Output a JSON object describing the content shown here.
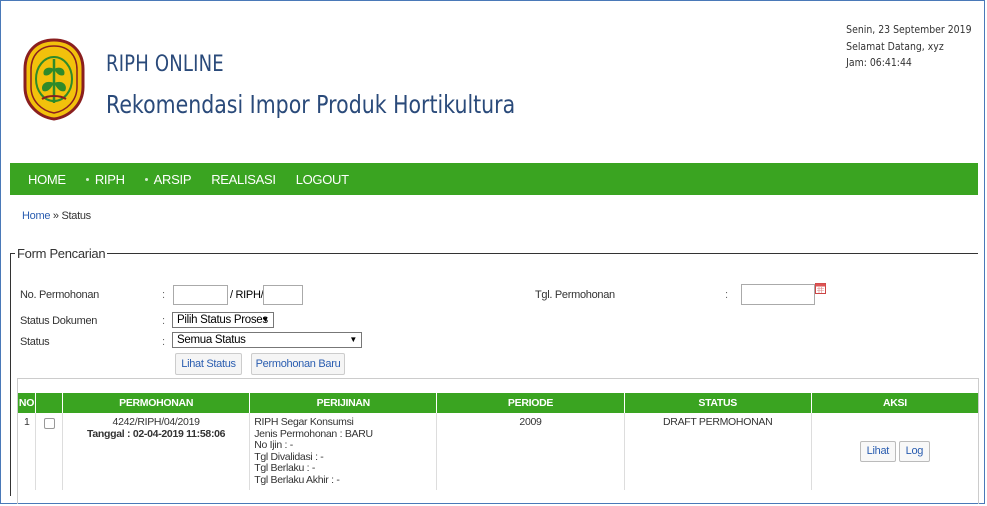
{
  "header": {
    "title": "RIPH ONLINE",
    "subtitle": "Rekomendasi Impor Produk Hortikultura",
    "date": "Senin, 23 September 2019",
    "greeting": "Selamat Datang, xyz",
    "clock": "Jam: 06:41:44"
  },
  "nav": {
    "items": [
      {
        "label": "HOME"
      },
      {
        "label": "RIPH"
      },
      {
        "label": "ARSIP"
      },
      {
        "label": "REALISASI"
      },
      {
        "label": "LOGOUT"
      }
    ]
  },
  "breadcrumb": {
    "home": "Home",
    "sep": " » ",
    "current": "Status"
  },
  "search": {
    "legend": "Form Pencarian",
    "no_permohonan_label": "No. Permohonan",
    "riph_sep": "/ RIPH/",
    "status_dokumen_label": "Status Dokumen",
    "status_dokumen_value": "Pilih Status Proses",
    "status_label": "Status",
    "status_value": "Semua Status",
    "tgl_permohonan_label": "Tgl. Permohonan",
    "colon": ":",
    "lihat_status_btn": "Lihat Status",
    "permohonan_baru_btn": "Permohonan Baru"
  },
  "table": {
    "headers": [
      "NO",
      "",
      "PERMOHONAN",
      "PERIJINAN",
      "PERIODE",
      "STATUS",
      "AKSI"
    ],
    "rows": [
      {
        "no": "1",
        "permohonan_no": "4242/RIPH/04/2019",
        "permohonan_tanggal": "Tanggal : 02-04-2019 11:58:06",
        "perijinan": [
          "RIPH Segar Konsumsi",
          "Jenis Permohonan : BARU",
          "No Ijin : -",
          "Tgl Divalidasi : -",
          "Tgl Berlaku : -",
          "Tgl Berlaku Akhir : -"
        ],
        "periode": "2009",
        "status": "DRAFT PERMOHONAN",
        "lihat": "Lihat",
        "log": "Log"
      }
    ]
  },
  "colors": {
    "nav_green": "#3aa421",
    "title_blue": "#2a4a7a",
    "link_blue": "#2a5db0"
  }
}
